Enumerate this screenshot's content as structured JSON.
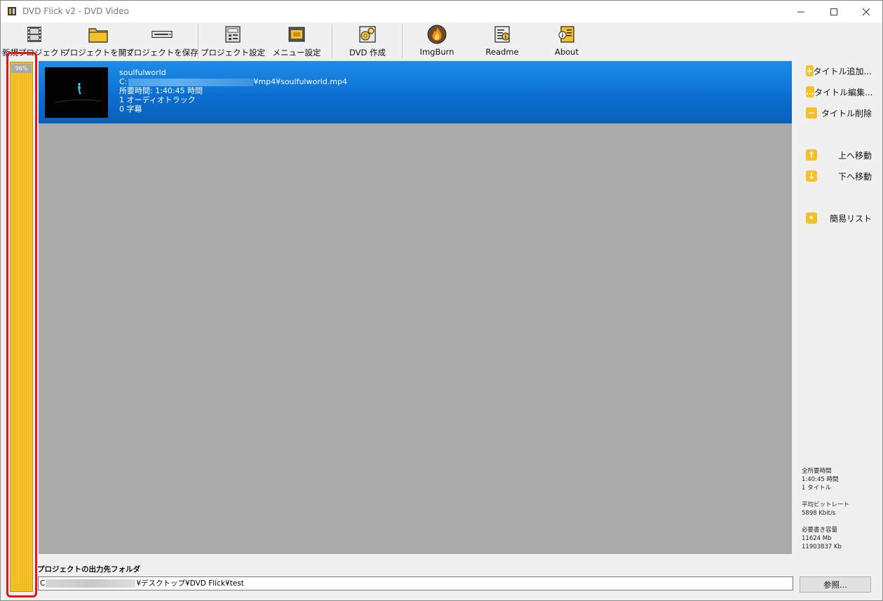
{
  "window": {
    "title": "DVD Flick v2 - DVD Video"
  },
  "toolbar": {
    "items": [
      {
        "label": "新規プロジェクト",
        "icon": "film-strip-icon"
      },
      {
        "label": "プロジェクトを開く",
        "icon": "folder-open-icon"
      },
      {
        "label": "プロジェクトを保存",
        "icon": "dvd-drive-save-icon"
      },
      {
        "label": "プロジェクト設定",
        "icon": "project-settings-icon"
      },
      {
        "label": "メニュー設定",
        "icon": "menu-settings-icon"
      },
      {
        "label": "DVD 作成",
        "icon": "dvd-create-gears-icon"
      },
      {
        "label": "ImgBurn",
        "icon": "imgburn-flame-icon"
      },
      {
        "label": "Readme",
        "icon": "readme-info-icon"
      },
      {
        "label": "About",
        "icon": "about-info-icon"
      }
    ]
  },
  "progress": {
    "label": "96%",
    "value_percent": 96,
    "color": "#f6c125",
    "highlight_color": "#e8141c"
  },
  "titles": [
    {
      "name": "soulfulworld",
      "path_prefix": "C:",
      "path_suffix": "¥mp4¥soulfulworld.mp4",
      "duration": "所要時間: 1:40:45 時間",
      "audio": "1 オーディオトラック",
      "subtitles": "0 字幕",
      "selected_color": "#0b6fd2"
    }
  ],
  "right_panel": {
    "buttons": [
      {
        "label": "タイトル追加...",
        "icon": "plus-icon",
        "glyph": "+"
      },
      {
        "label": "タイトル編集...",
        "icon": "ellipsis-icon",
        "glyph": "…"
      },
      {
        "label": "タイトル削除",
        "icon": "minus-icon",
        "glyph": "−"
      },
      {
        "label": "上へ移動",
        "icon": "arrow-up-icon",
        "glyph": "↑"
      },
      {
        "label": "下へ移動",
        "icon": "arrow-down-icon",
        "glyph": "↓"
      },
      {
        "label": "簡易リスト",
        "icon": "list-icon",
        "glyph": "•"
      }
    ],
    "stats": {
      "total_time_label": "全所要時間",
      "total_time_value": "1:40:45 時間",
      "title_count": "1 タイトル",
      "bitrate_label": "平均ビットレート",
      "bitrate_value": "5898 Kbit/s",
      "size_label": "必要書き容量",
      "size_mb": "11624 Mb",
      "size_kb": "11903837 Kb"
    }
  },
  "output": {
    "label": "プロジェクトの出力先フォルダ",
    "path_prefix": "C",
    "path_suffix": "¥デスクトップ¥DVD Flick¥test",
    "browse_label": "参照..."
  }
}
